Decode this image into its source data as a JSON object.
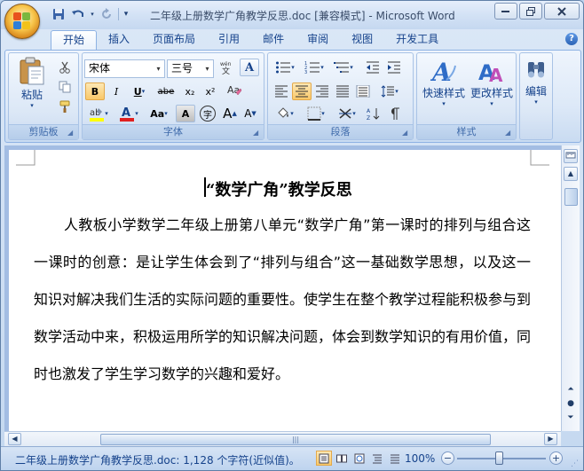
{
  "window": {
    "title": "二年级上册数学广角教学反思.doc [兼容模式] - Microsoft Word"
  },
  "qat": {
    "save_icon": "save-icon",
    "undo_icon": "undo-icon",
    "redo_icon": "redo-icon",
    "customize_icon": "dropdown-icon"
  },
  "ribbon": {
    "tabs": [
      "开始",
      "插入",
      "页面布局",
      "引用",
      "邮件",
      "审阅",
      "视图",
      "开发工具"
    ],
    "clipboard": {
      "label": "剪贴板",
      "paste": "粘贴"
    },
    "font": {
      "label": "字体",
      "font_name": "宋体",
      "font_size": "三号",
      "bold": "B",
      "italic": "I",
      "underline": "U",
      "strike": "abe",
      "subscript": "x₂",
      "superscript": "x²",
      "change_case": "Aa",
      "grow": "A",
      "shrink": "A",
      "font_color": "A",
      "char_border": "A",
      "enclose": "字"
    },
    "paragraph": {
      "label": "段落"
    },
    "styles": {
      "label": "样式",
      "quick_styles": "快速样式",
      "change_styles": "更改样式"
    },
    "editing": {
      "label": "编辑"
    },
    "colors": {
      "highlight": "#ffff00",
      "font_color": "#e02020"
    }
  },
  "document": {
    "title": "“数学广角”教学反思",
    "paragraph": "人教板小学数学二年级上册第八单元“数学广角”第一课时的排列与组合这一课时的创意：是让学生体会到了“排列与组合”这一基础数学思想，以及这一知识对解决我们生活的实际问题的重要性。使学生在整个教学过程能积极参与到数学活动中来，积极运用所学的知识解决问题，体会到数学知识的有用价值，同时也激发了学生学习数学的兴趣和爱好。"
  },
  "statusbar": {
    "info": "二年级上册数学广角教学反思.doc: 1,128 个字符(近似值)。",
    "zoom": "100%"
  }
}
